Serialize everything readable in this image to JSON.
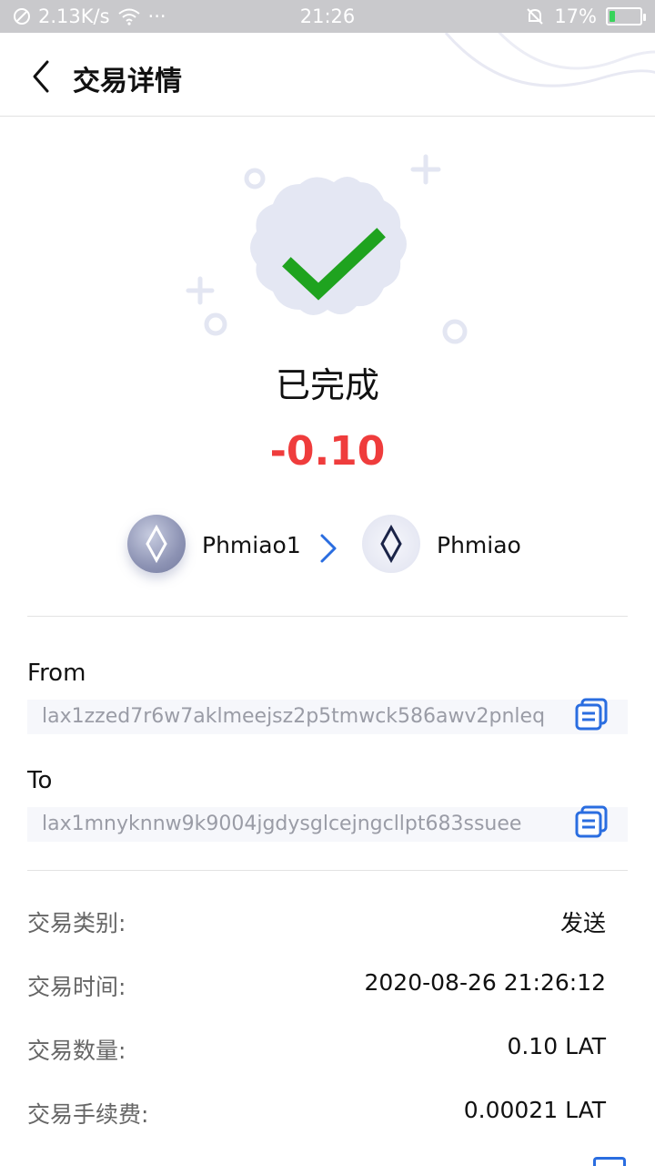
{
  "status_bar": {
    "network_speed": "2.13K/s",
    "more": "···",
    "time": "21:26",
    "battery_percent": "17%",
    "battery_level": 0.17
  },
  "header": {
    "title": "交易详情"
  },
  "status": {
    "label": "已完成",
    "amount": "-0.10"
  },
  "wallets": {
    "from_name": "Phmiao1",
    "to_name": "Phmiao"
  },
  "from": {
    "label": "From",
    "address": "lax1zzed7r6w7aklmeejsz2p5tmwck586awv2pnleq"
  },
  "to": {
    "label": "To",
    "address": "lax1mnyknnw9k9004jgdysglcejngcllpt683ssuee"
  },
  "details": [
    {
      "label": "交易类别:",
      "value": "发送"
    },
    {
      "label": "交易时间:",
      "value": "2020-08-26 21:26:12"
    },
    {
      "label": "交易数量:",
      "value": "0.10 LAT"
    },
    {
      "label": "交易手续费:",
      "value": "0.00021 LAT"
    }
  ],
  "colors": {
    "amount": "#ef3c3c",
    "check": "#1fa31f",
    "badge": "#e4e7f3",
    "accent_blue": "#2a6de0"
  }
}
